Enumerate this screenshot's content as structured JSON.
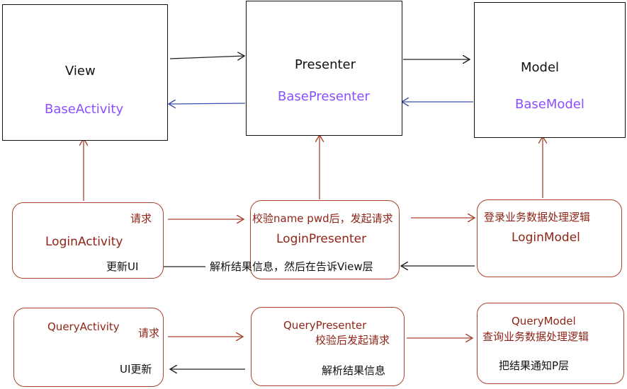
{
  "colors": {
    "black_arrow": "#222222",
    "blue_arrow": "#3a4fb0",
    "red_arrow": "#a9432e",
    "purple_text": "#8a4fff",
    "dark_red_text": "#8f2417"
  },
  "top_row": {
    "view": {
      "title": "View",
      "base": "BaseActivity"
    },
    "presenter": {
      "title": "Presenter",
      "base": "BasePresenter"
    },
    "model": {
      "title": "Model",
      "base": "BaseModel"
    }
  },
  "login_row": {
    "activity": {
      "name": "LoginActivity",
      "request_label": "请求",
      "update_label": "更新UI"
    },
    "presenter": {
      "name": "LoginPresenter",
      "request_label": "校验name pwd后，发起请求",
      "response_label": "解析结果信息，然后在告诉View层"
    },
    "model": {
      "name": "LoginModel",
      "logic_label": "登录业务数据处理逻辑"
    }
  },
  "query_row": {
    "activity": {
      "name": "QueryActivity",
      "request_label": "请求",
      "update_label": "UI更新"
    },
    "presenter": {
      "name": "QueryPresenter",
      "request_label": "校验后发起请求",
      "response_label": "解析结果信息"
    },
    "model": {
      "name": "QueryModel",
      "logic_label": "查询业务数据处理逻辑",
      "notify_label": "把结果通知P层"
    }
  }
}
